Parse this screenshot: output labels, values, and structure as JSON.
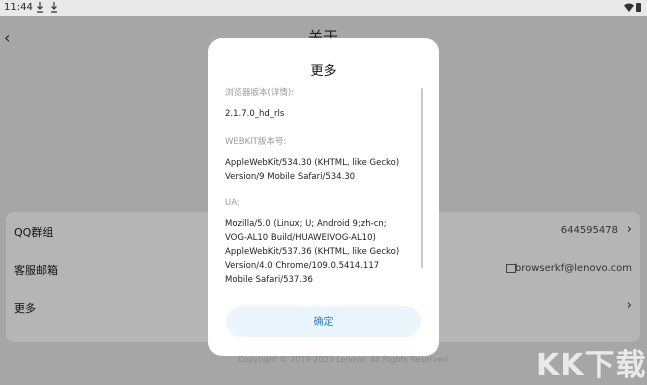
{
  "status_bar": {
    "time": "11:44",
    "icons": [
      "download-icon",
      "download-icon",
      "wifi-icon",
      "battery-icon"
    ]
  },
  "header": {
    "title": "关于",
    "back_icon": "chevron-left-icon"
  },
  "settings": {
    "rows": [
      {
        "label": "QQ群组",
        "value": "644595478",
        "icon": "chevron-right-icon"
      },
      {
        "label": "客服邮箱",
        "value": "browserkf@lenovo.com",
        "icon": "mail-icon"
      },
      {
        "label": "更多",
        "value": "",
        "icon": "chevron-right-icon"
      }
    ],
    "footer": "Copyright © 2019-2023 Lenovo. All Rights Reserved"
  },
  "dialog": {
    "title": "更多",
    "sections": [
      {
        "label": "浏览器版本(详情):",
        "value": "2.1.7.0_hd_rls"
      },
      {
        "label": "WEBKIT版本号:",
        "value": "AppleWebKit/534.30 (KHTML, like Gecko)\nVersion/9 Mobile Safari/534.30"
      },
      {
        "label": "UA:",
        "value": "Mozilla/5.0 (Linux; U; Android 9;zh-cn;\nVOG-AL10 Build/HUAWEIVOG-AL10)\nAppleWebKit/537.36 (KHTML, like Gecko)\nVersion/4.0 Chrome/109.0.5414.117\nMobile Safari/537.36"
      }
    ],
    "confirm_label": "确定"
  },
  "watermark": "KK下载",
  "colors": {
    "accent": "#2b7fd1",
    "button_bg": "#eaf5fc",
    "overlay": "#a6a6a6"
  }
}
